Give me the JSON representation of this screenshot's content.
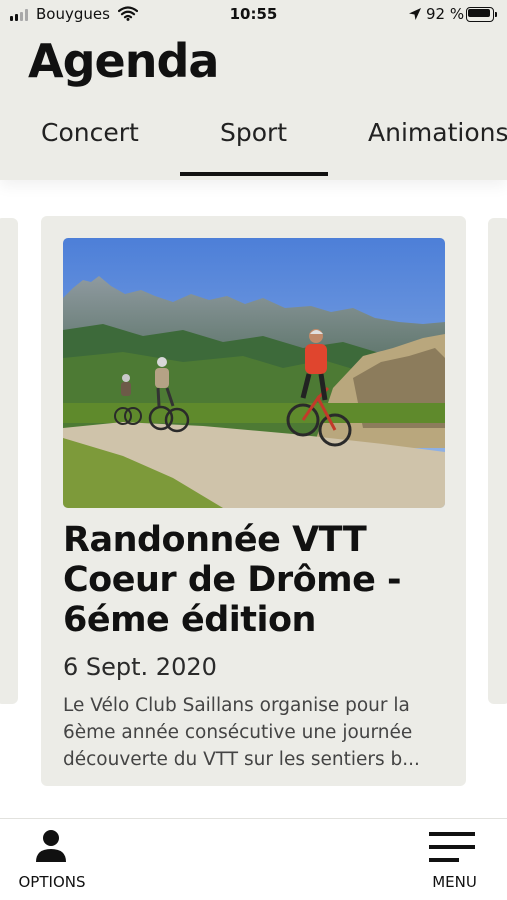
{
  "status_bar": {
    "carrier": "Bouygues",
    "time": "10:55",
    "battery_percent": "92 %",
    "battery_level": 0.92,
    "icons": [
      "signal-icon",
      "wifi-icon",
      "location-arrow-icon",
      "battery-icon"
    ]
  },
  "header": {
    "title": "Agenda"
  },
  "tabs": [
    {
      "label": "Concert",
      "selected": false
    },
    {
      "label": "Sport",
      "selected": true
    },
    {
      "label": "Animations",
      "selected": false
    }
  ],
  "event_card": {
    "title": "Randonnée VTT Coeur de Drôme - 6éme édition",
    "date": "6 Sept. 2020",
    "description": "Le Vélo Club Saillans organise pour la 6ème année consécutive une journée découverte du VTT sur les sentiers b..."
  },
  "bottom_nav": {
    "options_label": "OPTIONS",
    "menu_label": "MENU",
    "options_icon": "person-icon",
    "menu_icon": "hamburger-menu-icon"
  },
  "colors": {
    "header_bg": "#ecece7",
    "card_bg": "#ecece7",
    "text": "#111111",
    "active_tab_underline": "#111111"
  }
}
